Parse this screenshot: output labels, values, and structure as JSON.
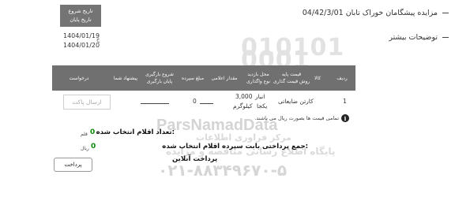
{
  "header": {
    "title": "مزایده پیشگامان خوراک تابان 04/42/3/01",
    "more_details": "توضیحات بیشتر"
  },
  "dates": {
    "start_label": "تاریخ شروع",
    "end_label": "تاریخ پایان",
    "start_value": "1404/01/19",
    "end_value": "1404/01/20",
    "marker": "ج"
  },
  "table": {
    "columns": {
      "row": "ردیف",
      "item": "کالا",
      "base_price": "قیمت پایه",
      "pricing_method": "روش قیمت گذاری",
      "visit_place": "محل بازدید",
      "transfer_type": "نوع واگذاری",
      "quantity": "مقدار اعلامی",
      "deposit": "مبلغ سپرده",
      "bid_start": "شروع بارگیری",
      "bid_end": "پایان بارگیری",
      "your_offer": "پیشنهاد شما",
      "request": "درخواست"
    },
    "rows": [
      {
        "row": "1",
        "item": "کارتن ضایعاتی",
        "base_price": "3,000",
        "unit": "کیلوگرم",
        "visit_place": "انبار",
        "transfer_type": "یکجا",
        "deposit": "0",
        "send_offer": "ارسال پاکت"
      }
    ]
  },
  "note": {
    "info_icon": "i",
    "text": "تمامی قیمت ها بصورت ریال می باشند."
  },
  "summary": {
    "selected_label": "تعداد اقلام انتخاب شده:",
    "selected_value": "0",
    "selected_unit": "قلم",
    "deposit_label": "جمع پرداختی بابت سپرده اقلام انتخاب شده:",
    "deposit_value": "0",
    "deposit_unit": "ریال",
    "online_label": "پرداخت آنلاین"
  },
  "pay_button": "پرداخت",
  "watermark": {
    "digits_1": "010101",
    "digits_2": "0001",
    "brand": "ParsNamadData",
    "line1": "مرکز فراوری اطلاعات",
    "line2": "پایگاه اطلاع رسانی مناقصه و مزایده",
    "phone": "۰۲۱-۸۸۳۴۹۶۷۰-۵"
  },
  "colors": {
    "table_header_bg": "#707070",
    "date_box_bg": "#747474",
    "value_green": "#0a8a0a"
  }
}
